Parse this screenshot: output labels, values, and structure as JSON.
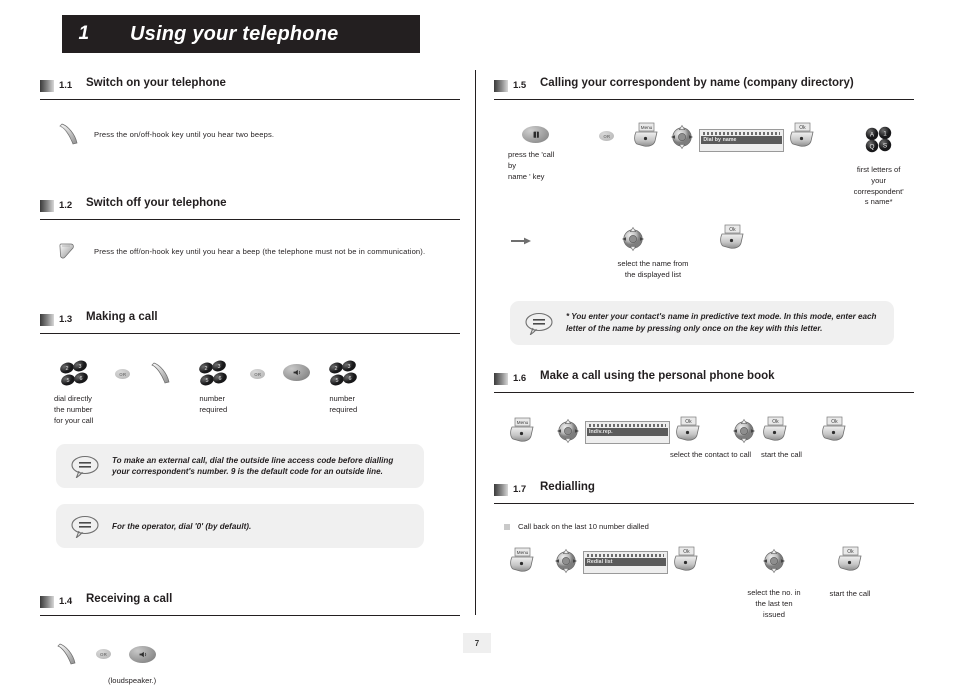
{
  "chapter": {
    "number": "1",
    "title": "Using your telephone"
  },
  "page_number": "7",
  "sections": {
    "s11": {
      "num": "1.1",
      "title": "Switch on your telephone",
      "instruction": "Press the on/off-hook key until you hear two beeps."
    },
    "s12": {
      "num": "1.2",
      "title": "Switch off your telephone",
      "instruction": "Press the off/on-hook key until you hear a beep (the telephone must not be in communication)."
    },
    "s13": {
      "num": "1.3",
      "title": "Making a call",
      "steps": {
        "l1": "dial directly\nthe number\nfor your call",
        "or1": "OR",
        "l2": "number\nrequired",
        "or2": "OR",
        "l3": "number\nrequired"
      },
      "tip1": "To make an external call, dial the outside line access code before dialling your correspondent's number. 9 is the default code for an outside line.",
      "tip2": "For the operator, dial '0' (by default)."
    },
    "s14": {
      "num": "1.4",
      "title": "Receiving a call",
      "or": "OR",
      "label": "(loudspeaker.)"
    },
    "s15": {
      "num": "1.5",
      "title": "Calling your correspondent by name (company directory)",
      "steps": {
        "l1": "press the 'call by\nname ' key",
        "or": "OR",
        "menu_key": "Menu",
        "screen": "Dial by name",
        "ok_key": "Ok",
        "l2": "first letters of\nyour\ncorrespondent'\ns name*"
      },
      "row2": {
        "ok_key": "Ok",
        "label": "select the name from\nthe displayed list"
      },
      "tip": "* You enter your contact's name in predictive text mode. In this mode, enter each letter of the name by pressing only once on the key with this letter."
    },
    "s16": {
      "num": "1.6",
      "title": "Make a call using the personal phone book",
      "steps": {
        "menu_key": "Menu",
        "screen": "Indiv.rep.",
        "ok_key1": "Ok",
        "ok_key2": "Ok",
        "ok_key3": "Ok",
        "label1": "select the contact to call",
        "label2": "start the call"
      }
    },
    "s17": {
      "num": "1.7",
      "title": "Redialling",
      "bullet": "Call back on the last 10 number dialled",
      "steps": {
        "menu_key": "Menu",
        "screen": "Redial list",
        "ok_key1": "Ok",
        "ok_key2": "Ok",
        "label1": "select the no. in\nthe last ten\nissued",
        "label2": "start the call"
      }
    }
  },
  "icons": {
    "keypad_digits": [
      "2",
      "5",
      "3",
      "6"
    ],
    "keypad_letters": [
      "A",
      "1",
      "Q",
      "S"
    ]
  }
}
